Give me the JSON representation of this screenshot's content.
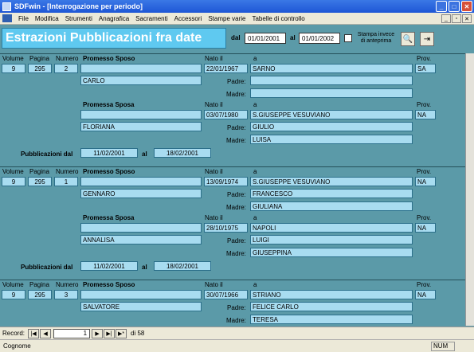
{
  "window": {
    "title": "SDFwin - [Interrogazione per periodo]"
  },
  "menu": [
    "File",
    "Modifica",
    "Strumenti",
    "Anagrafica",
    "Sacramenti",
    "Accessori",
    "Stampe varie",
    "Tabelle di controllo"
  ],
  "header": {
    "title": "Estrazioni Pubblicazioni fra date",
    "dal_label": "dal",
    "dal_value": "01/01/2001",
    "al_label": "al",
    "al_value": "01/01/2002",
    "stampa_label_1": "Stampa invece",
    "stampa_label_2": "di anteprima"
  },
  "labels": {
    "volume": "Volume",
    "pagina": "Pagina",
    "numero": "Numero",
    "promesso_sposo": "Promesso Sposo",
    "promessa_sposa": "Promessa Sposa",
    "nato_il": "Nato il",
    "a": "a",
    "prov": "Prov.",
    "padre": "Padre:",
    "madre": "Madre:",
    "pubblicazioni_dal": "Pubblicazioni dal",
    "al": "al"
  },
  "records": [
    {
      "volume": "9",
      "pagina": "295",
      "numero": "2",
      "sposo_cognome": "",
      "sposo_nome": "CARLO",
      "sposo_nato": "22/01/1967",
      "sposo_luogo": "SARNO",
      "sposo_prov": "SA",
      "sposo_padre": "",
      "sposo_madre": "",
      "sposa_cognome": "",
      "sposa_nome": "FLORIANA",
      "sposa_nato": "03/07/1980",
      "sposa_luogo": "S.GIUSEPPE VESUVIANO",
      "sposa_prov": "NA",
      "sposa_padre": "GIULIO",
      "sposa_madre": "LUISA",
      "pub_dal": "11/02/2001",
      "pub_al": "18/02/2001"
    },
    {
      "volume": "9",
      "pagina": "295",
      "numero": "1",
      "sposo_cognome": "",
      "sposo_nome": "GENNARO",
      "sposo_nato": "13/09/1974",
      "sposo_luogo": "S.GIUSEPPE VESUVIANO",
      "sposo_prov": "NA",
      "sposo_padre": "FRANCESCO",
      "sposo_madre": "GIULIANA",
      "sposa_cognome": "",
      "sposa_nome": "ANNALISA",
      "sposa_nato": "28/10/1975",
      "sposa_luogo": "NAPOLI",
      "sposa_prov": "NA",
      "sposa_padre": "LUIGI",
      "sposa_madre": "GIUSEPPINA",
      "pub_dal": "11/02/2001",
      "pub_al": "18/02/2001"
    },
    {
      "volume": "9",
      "pagina": "295",
      "numero": "3",
      "sposo_cognome": "",
      "sposo_nome": "SALVATORE",
      "sposo_nato": "30/07/1966",
      "sposo_luogo": "STRIANO",
      "sposo_prov": "NA",
      "sposo_padre": "FELICE CARLO",
      "sposo_madre": "TERESA"
    }
  ],
  "nav": {
    "label": "Record:",
    "current": "1",
    "of": "di 58"
  },
  "status": {
    "field": "Cognome",
    "num": "NUM"
  }
}
